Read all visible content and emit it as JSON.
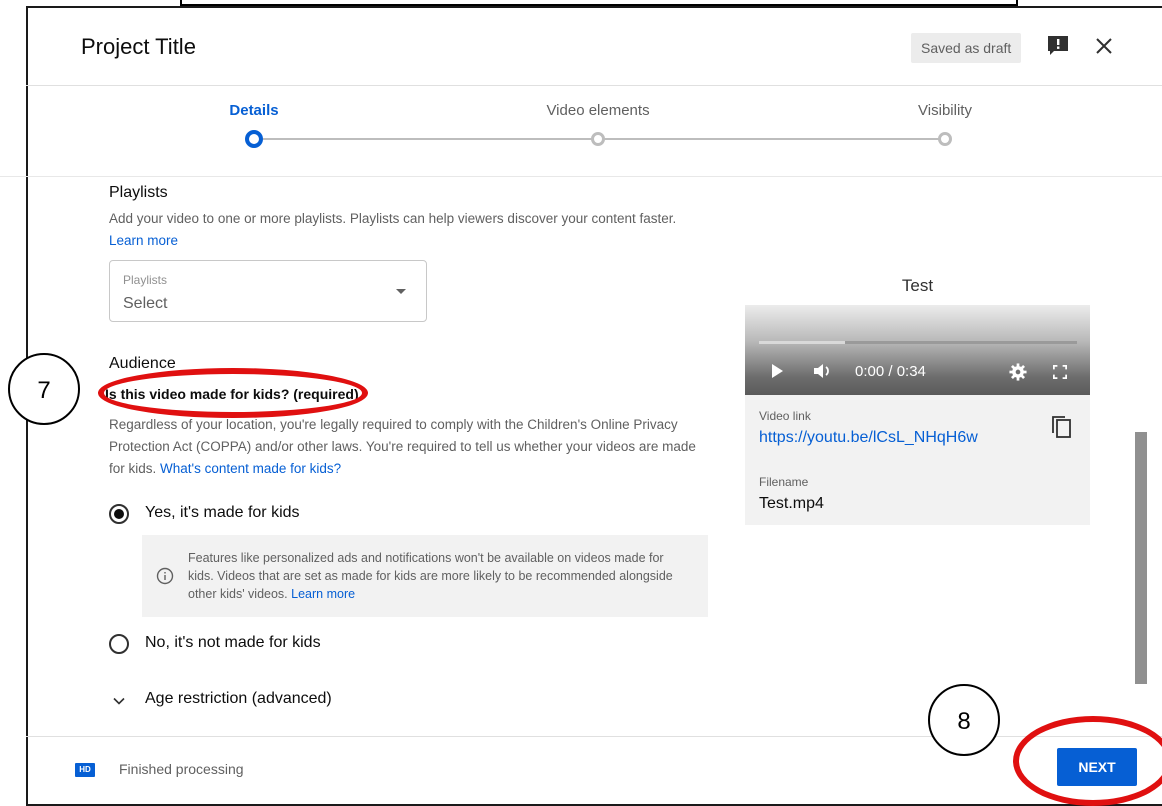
{
  "header": {
    "title": "Project Title",
    "draft_badge": "Saved as draft"
  },
  "stepper": {
    "steps": [
      {
        "label": "Details",
        "state": "active"
      },
      {
        "label": "Video elements",
        "state": "inactive"
      },
      {
        "label": "Visibility",
        "state": "inactive"
      }
    ]
  },
  "playlists": {
    "title": "Playlists",
    "description": "Add your video to one or more playlists. Playlists can help viewers discover your content faster.",
    "learn_more": "Learn more",
    "select_label": "Playlists",
    "select_value": "Select"
  },
  "audience": {
    "title": "Audience",
    "question": "Is this video made for kids? (required)",
    "description": "Regardless of your location, you're legally required to comply with the Children's Online Privacy Protection Act (COPPA) and/or other laws. You're required to tell us whether your videos are made for kids.",
    "description_link": "What's content made for kids?",
    "option_yes": "Yes, it's made for kids",
    "option_no": "No, it's not made for kids",
    "selected": "yes",
    "info_text": "Features like personalized ads and notifications won't be available on videos made for kids. Videos that are set as made for kids are more likely to be recommended alongside other kids' videos.",
    "info_link": "Learn more",
    "age_restriction": "Age restriction (advanced)"
  },
  "video": {
    "title": "Test",
    "time": "0:00 / 0:34",
    "progress_buffered": 0.27,
    "link_label": "Video link",
    "link": "https://youtu.be/lCsL_NHqH6w",
    "filename_label": "Filename",
    "filename": "Test.mp4"
  },
  "footer": {
    "hd_badge": "HD",
    "status": "Finished processing",
    "next_label": "NEXT"
  },
  "annotations": {
    "step7": "7",
    "step8": "8"
  },
  "colors": {
    "accent": "#065fd4",
    "annotation_red": "#e01010"
  }
}
